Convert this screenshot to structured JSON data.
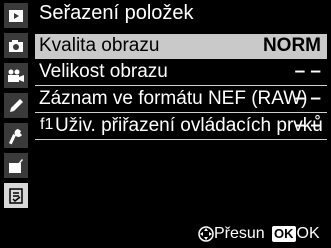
{
  "screen": {
    "title": "Seřazení položek"
  },
  "sidebar": {
    "tabs": [
      {
        "icon": "playback-icon"
      },
      {
        "icon": "camera-icon"
      },
      {
        "icon": "movie-camera-icon"
      },
      {
        "icon": "pencil-icon"
      },
      {
        "icon": "wrench-icon"
      },
      {
        "icon": "retouch-icon"
      },
      {
        "icon": "my-menu-icon"
      }
    ]
  },
  "items": [
    {
      "label": "Kvalita obrazu",
      "value": "NORM"
    },
    {
      "label": "Velikost obrazu",
      "value": "– –"
    },
    {
      "label": "Záznam ve formátu NEF (RAW)",
      "value": "– –"
    },
    {
      "prefix": "f1",
      "label": "Uživ. přiřazení ovládacích prvků",
      "value": "– –"
    }
  ],
  "footer": {
    "move_label": "Přesun",
    "ok_key": "OK",
    "ok_label": "OK"
  },
  "colors": {
    "selection_bg": "#c9c9c9",
    "tab_bg": "#3a3a3a",
    "active_tab_bg": "#d8d8d8"
  }
}
